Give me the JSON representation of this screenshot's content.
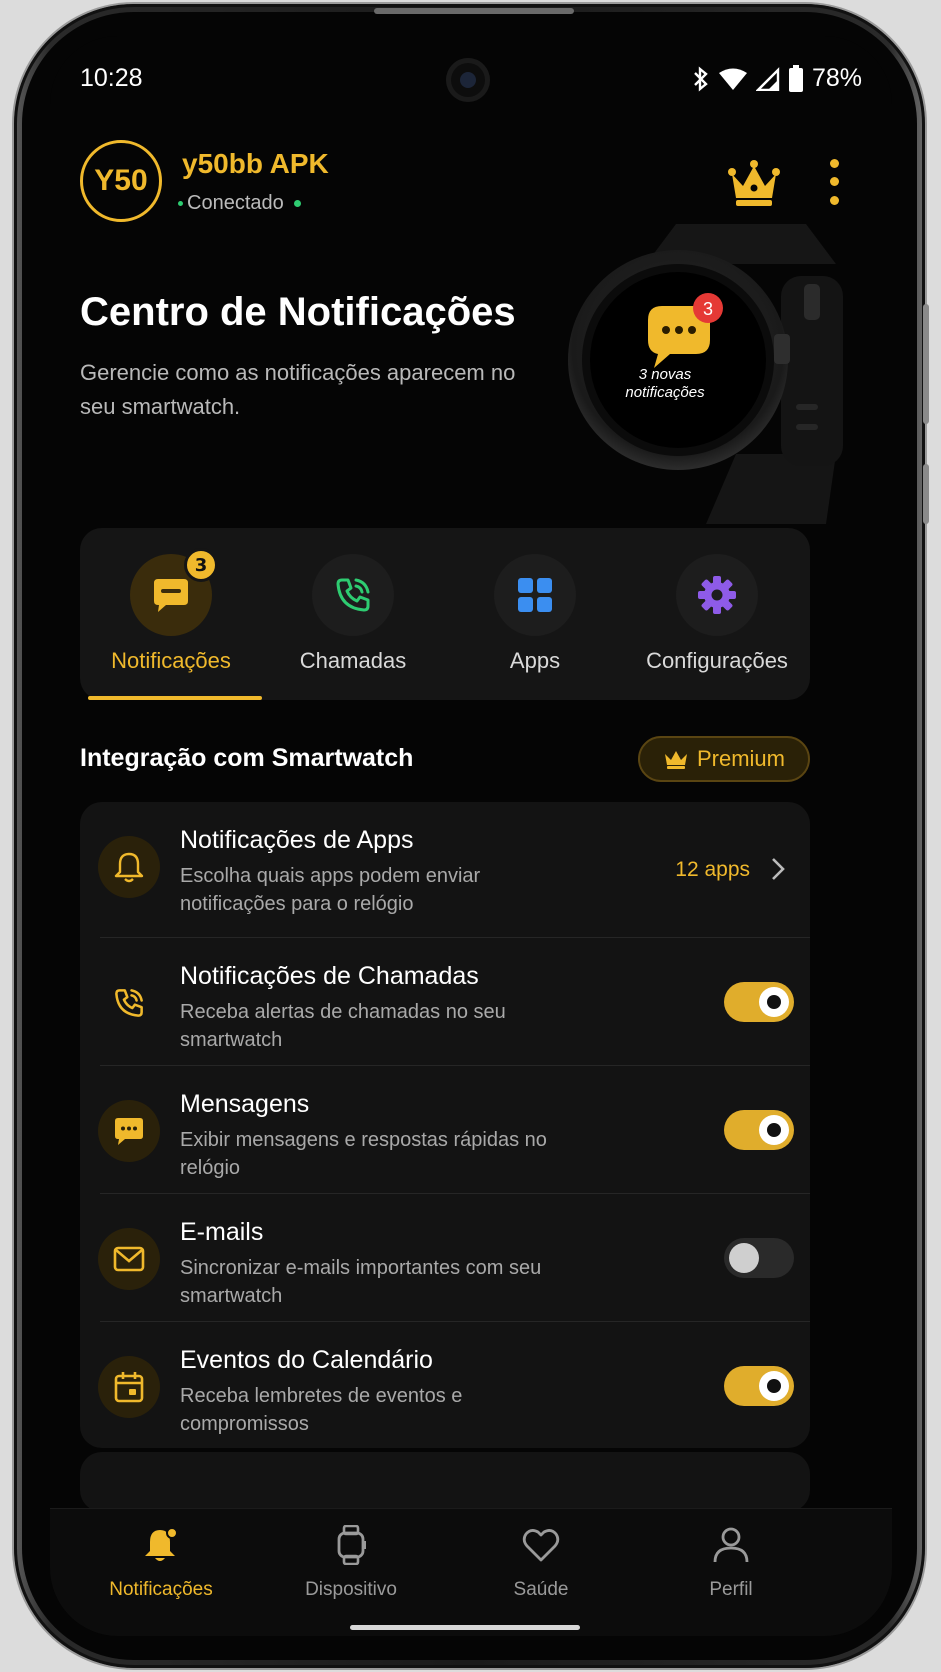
{
  "status": {
    "time": "10:28",
    "battery": "78%"
  },
  "header": {
    "avatar_text": "Y50",
    "app_name": "y50bb APK",
    "connection": "Conectado"
  },
  "hero": {
    "title": "Centro de Notificações",
    "subtitle": "Gerencie como as notificações aparecem no seu smartwatch.",
    "watch_badge": "3",
    "watch_text": "3 novas notificações"
  },
  "tabs": [
    {
      "label": "Notificações",
      "badge": "3",
      "icon": "chat-icon",
      "active": true
    },
    {
      "label": "Chamadas",
      "icon": "phone-icon"
    },
    {
      "label": "Apps",
      "icon": "grid-icon"
    },
    {
      "label": "Configurações",
      "icon": "gear-icon"
    }
  ],
  "section": {
    "title": "Integração com Smartwatch",
    "premium_label": "Premium"
  },
  "settings": [
    {
      "title": "Notificações de Apps",
      "desc": "Escolha quais apps podem enviar notificações para o relógio",
      "meta": "12 apps",
      "icon": "bell-icon"
    },
    {
      "title": "Notificações de Chamadas",
      "desc": "Receba alertas de chamadas no seu smartwatch",
      "toggle": true,
      "icon": "phone-icon"
    },
    {
      "title": "Mensagens",
      "desc": "Exibir mensagens e respostas rápidas no relógio",
      "toggle": true,
      "icon": "message-icon"
    },
    {
      "title": "E-mails",
      "desc": "Sincronizar e-mails importantes com seu smartwatch",
      "toggle": false,
      "icon": "mail-icon"
    },
    {
      "title": "Eventos do Calendário",
      "desc": "Receba lembretes de eventos e compromissos",
      "toggle": true,
      "icon": "calendar-icon"
    }
  ],
  "bottom_nav": [
    {
      "label": "Notificações",
      "icon": "bell-icon",
      "active": true
    },
    {
      "label": "Dispositivo",
      "icon": "watch-icon"
    },
    {
      "label": "Saúde",
      "icon": "heart-icon"
    },
    {
      "label": "Perfil",
      "icon": "user-icon"
    }
  ],
  "colors": {
    "accent": "#f0b92c",
    "background": "#050505",
    "card": "#131313",
    "green": "#2ecc71",
    "blue": "#3b8ef0",
    "purple": "#8e5be8",
    "red": "#e53935"
  }
}
